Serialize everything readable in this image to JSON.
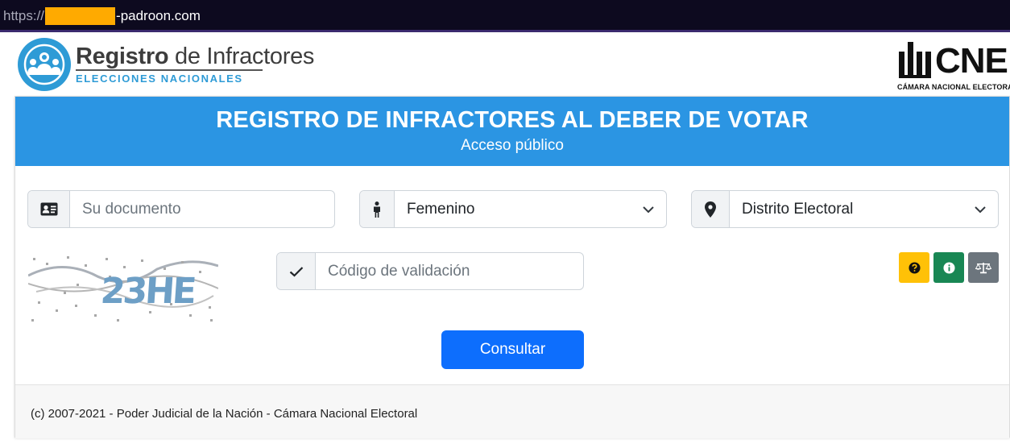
{
  "browser": {
    "url_protocol": "https://",
    "url_domain": "-padroon.com"
  },
  "header": {
    "logo_title_bold": "Registro",
    "logo_title_light": " de Infractores",
    "logo_subtitle": "ELECCIONES NACIONALES",
    "cne_word": "CNE",
    "cne_subtitle": "CÁMARA NACIONAL ELECTORAL"
  },
  "banner": {
    "title": "REGISTRO DE INFRACTORES AL DEBER DE VOTAR",
    "subtitle": "Acceso público"
  },
  "form": {
    "document_placeholder": "Su documento",
    "gender_selected": "Femenino",
    "district_selected": "Distrito Electoral",
    "validation_placeholder": "Código de validación",
    "captcha_text": "23HE",
    "submit_label": "Consultar"
  },
  "icons": {
    "document": "id-card-icon",
    "gender": "person-icon",
    "district": "map-marker-icon",
    "validation": "check-icon",
    "help": "question-icon",
    "info": "info-icon",
    "legal": "balance-scale-icon"
  },
  "colors": {
    "banner": "#2b95e3",
    "primary": "#0d6efd",
    "help_button": "#ffc107",
    "info_button": "#198754",
    "legal_button": "#6c757d",
    "url_redaction": "#ffaa00"
  },
  "footer": {
    "text": "(c) 2007-2021 - Poder Judicial de la Nación - Cámara Nacional Electoral"
  }
}
